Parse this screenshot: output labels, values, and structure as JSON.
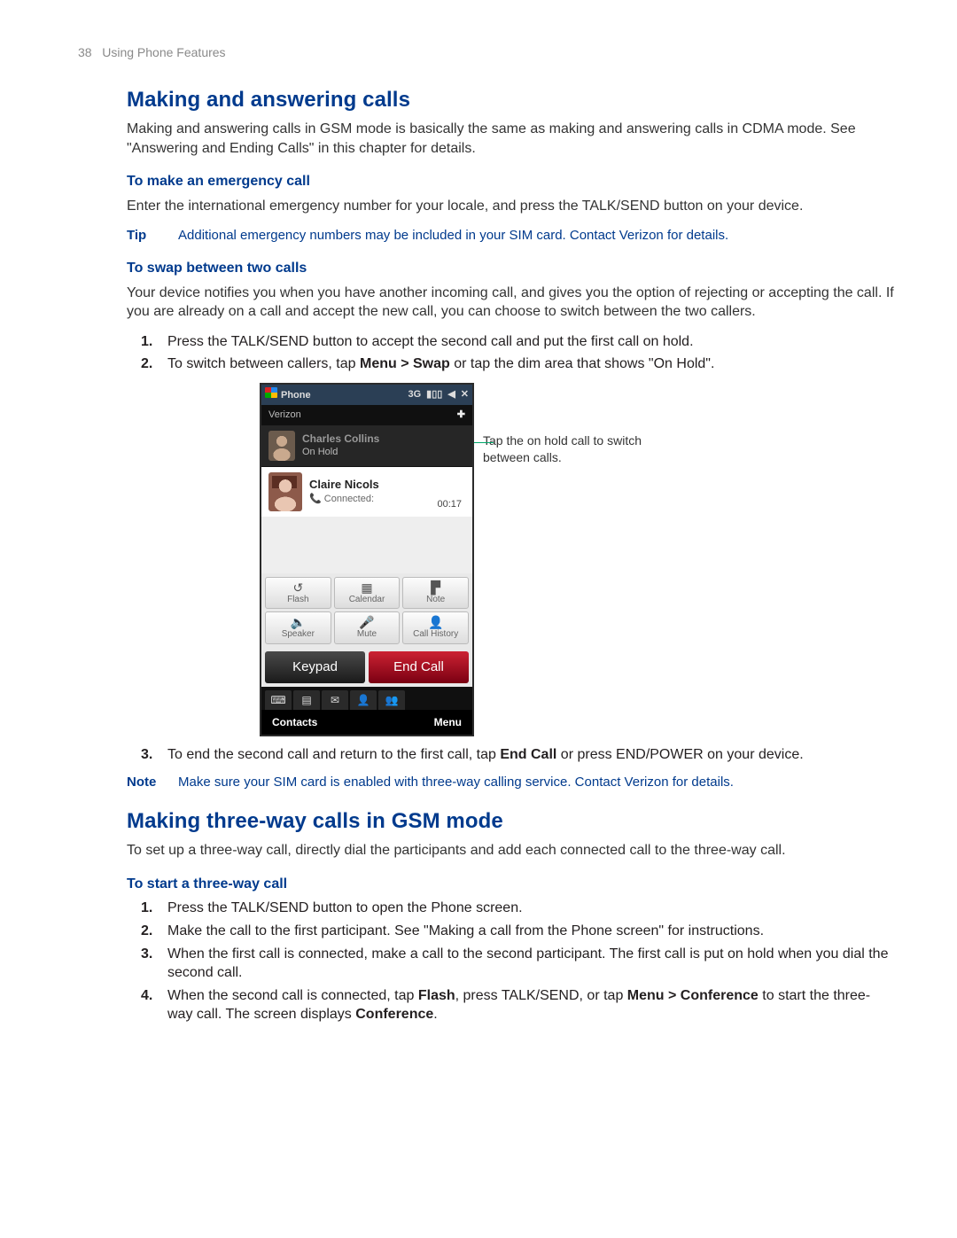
{
  "header": {
    "page_num": "38",
    "section": "Using Phone Features"
  },
  "s1": {
    "title": "Making and answering calls",
    "intro": "Making and answering calls in GSM mode is basically the same as making and answering calls in CDMA mode. See \"Answering and Ending Calls\" in this chapter for details.",
    "sub1": {
      "title": "To make an emergency call",
      "p": "Enter the international emergency number for your locale, and press the TALK/SEND button on your device.",
      "tip_label": "Tip",
      "tip": "Additional emergency numbers may be included in your SIM card. Contact Verizon for details."
    },
    "sub2": {
      "title": "To swap between two calls",
      "p": "Your device notifies you when you have another incoming call, and gives you the option of rejecting or accepting the call. If you are already on a call and accept the new call, you can choose to switch between the two callers.",
      "steps": {
        "n1": "1.",
        "t1": "Press the TALK/SEND button to accept the second call and put the first call on hold.",
        "n2": "2.",
        "t2a": "To switch between callers, tap ",
        "t2b": "Menu > Swap",
        "t2c": " or tap the dim area that shows \"On Hold\".",
        "n3": "3.",
        "t3a": "To end the second call and return to the first call, tap ",
        "t3b": "End Call",
        "t3c": " or press END/POWER on your device."
      },
      "note_label": "Note",
      "note": "Make sure your SIM card is enabled with three-way calling service. Contact Verizon for details."
    }
  },
  "s2": {
    "title": "Making three-way calls in GSM mode",
    "intro": "To set up a three-way call, directly dial the participants and add each connected call to the three-way call.",
    "sub1": {
      "title": "To start a three-way call",
      "steps": {
        "n1": "1.",
        "t1": "Press the TALK/SEND button to open the Phone screen.",
        "n2": "2.",
        "t2": "Make the call to the first participant. See \"Making a call from the Phone screen\" for instructions.",
        "n3": "3.",
        "t3": "When the first call is connected, make a call to the second participant. The first call is put on hold when you dial the second call.",
        "n4": "4.",
        "t4a": "When the second call is connected, tap ",
        "t4b": "Flash",
        "t4c": ", press TALK/SEND, or tap ",
        "t4d": "Menu > Conference",
        "t4e": " to start the three-way call. The screen displays ",
        "t4f": "Conference",
        "t4g": "."
      }
    }
  },
  "phone": {
    "title": "Phone",
    "status_3g": "3G",
    "carrier": "Verizon",
    "plus": "✚",
    "hold_name": "Charles Collins",
    "hold_status": "On Hold",
    "active_name": "Claire Nicols",
    "active_status": "Connected:",
    "active_time": "00:17",
    "btns": {
      "flash": "Flash",
      "calendar": "Calendar",
      "note": "Note",
      "speaker": "Speaker",
      "mute": "Mute",
      "history": "Call History"
    },
    "keypad": "Keypad",
    "endcall": "End Call",
    "soft_left": "Contacts",
    "soft_right": "Menu"
  },
  "callout": "Tap the on hold call to switch between calls."
}
